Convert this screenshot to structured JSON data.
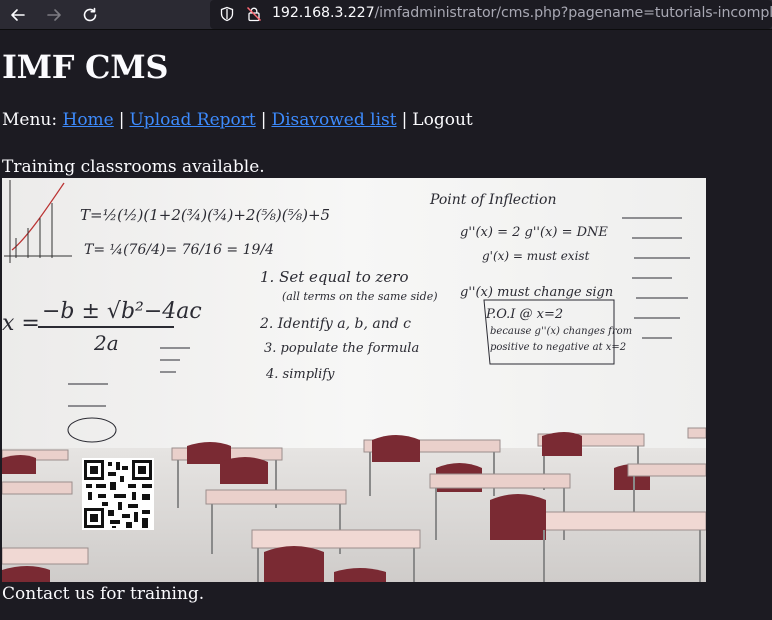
{
  "browser": {
    "url_host": "192.168.3.227",
    "url_path": "/imfadministrator/cms.php?pagename=tutorials-incomplete"
  },
  "page": {
    "title": "IMF CMS",
    "menu_prefix": "Menu:",
    "menu": {
      "home": "Home",
      "upload": "Upload Report",
      "disavowed": "Disavowed list",
      "logout": "Logout"
    },
    "separator": "|",
    "intro": "Training classrooms available.",
    "footer": "Contact us for training."
  },
  "whiteboard": {
    "left_lines": [
      "T=½(½)(1+2(¾)(¾)+2(⅝)(⅝)+5",
      "T= ¼(76/4)= 76/16 = 19/4"
    ],
    "formula_numerator": "−b ± √b²−4ac",
    "formula_denominator": "2a",
    "formula_x": "x =",
    "steps": [
      "1. Set equal to zero",
      "(all terms on the same side)",
      "2. Identify a, b, and c",
      "3. populate the formula",
      "4. simplify"
    ],
    "right_title": "Point of Inflection",
    "right_lines": [
      "g''(x) = 2   g''(x) = DNE",
      "g'(x) = must exist",
      "g''(x) must change sign",
      "P.O.I @ x=2",
      "because g''(x) changes from",
      "positive to negative at x=2"
    ]
  },
  "colors": {
    "accent_link": "#3d8bfd",
    "page_bg": "#1c1b22",
    "toolbar_bg": "#2b2a33",
    "chair": "#7a2a33",
    "desk_top": "#e9c9c4"
  }
}
